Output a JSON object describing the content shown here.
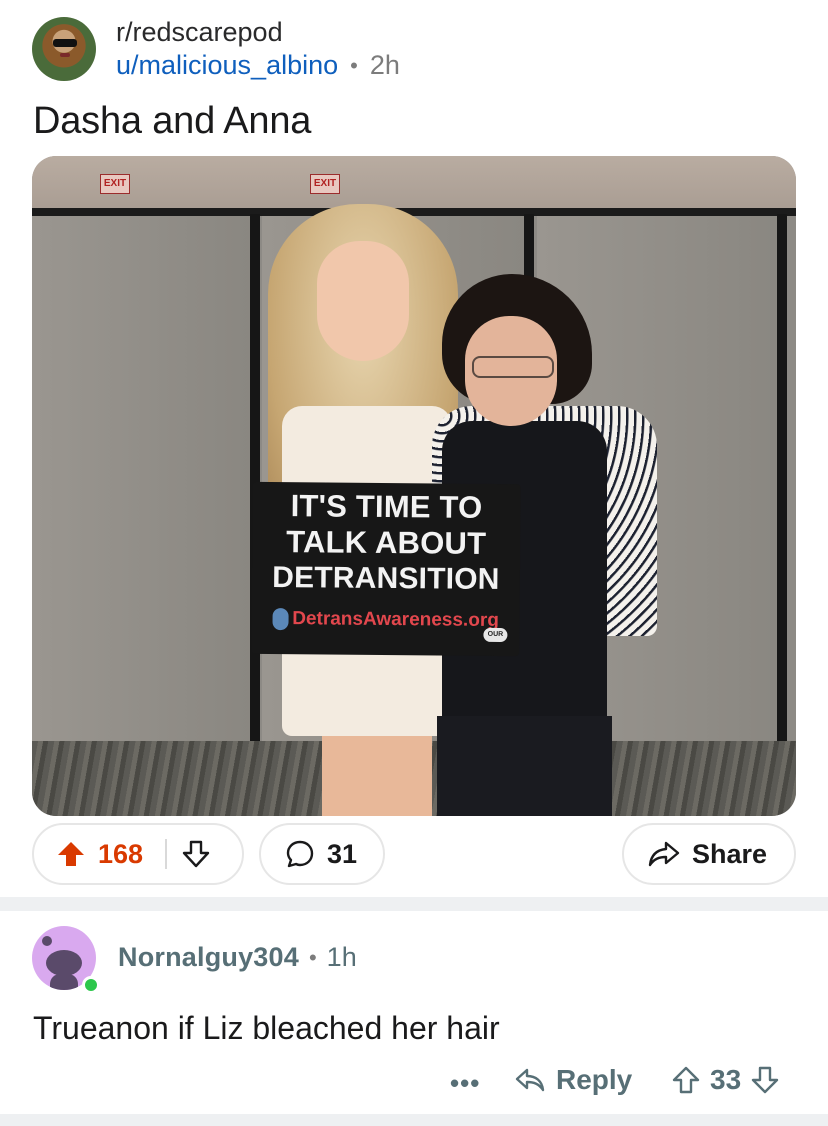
{
  "post": {
    "subreddit": "r/redscarepod",
    "author": "u/malicious_albino",
    "separator": "•",
    "age": "2h",
    "title": "Dasha and Anna"
  },
  "image": {
    "sign_lines": [
      "IT'S TIME TO",
      "TALK ABOUT",
      "DETRANSITION"
    ],
    "sign_url": "DetransAwareness.org",
    "sign_badge": "OUR",
    "exit_sign": "EXIT"
  },
  "actions": {
    "upvotes": "168",
    "comments": "31",
    "share_label": "Share",
    "upvote_color": "#d93a00"
  },
  "comment": {
    "author": "Nornalguy304",
    "separator": "•",
    "age": "1h",
    "body": "Trueanon if Liz bleached her hair",
    "more_label": "•••",
    "reply_label": "Reply",
    "score": "33"
  },
  "icons": [
    "upvote-icon",
    "downvote-icon",
    "comment-icon",
    "share-icon",
    "reply-icon",
    "more-icon"
  ]
}
